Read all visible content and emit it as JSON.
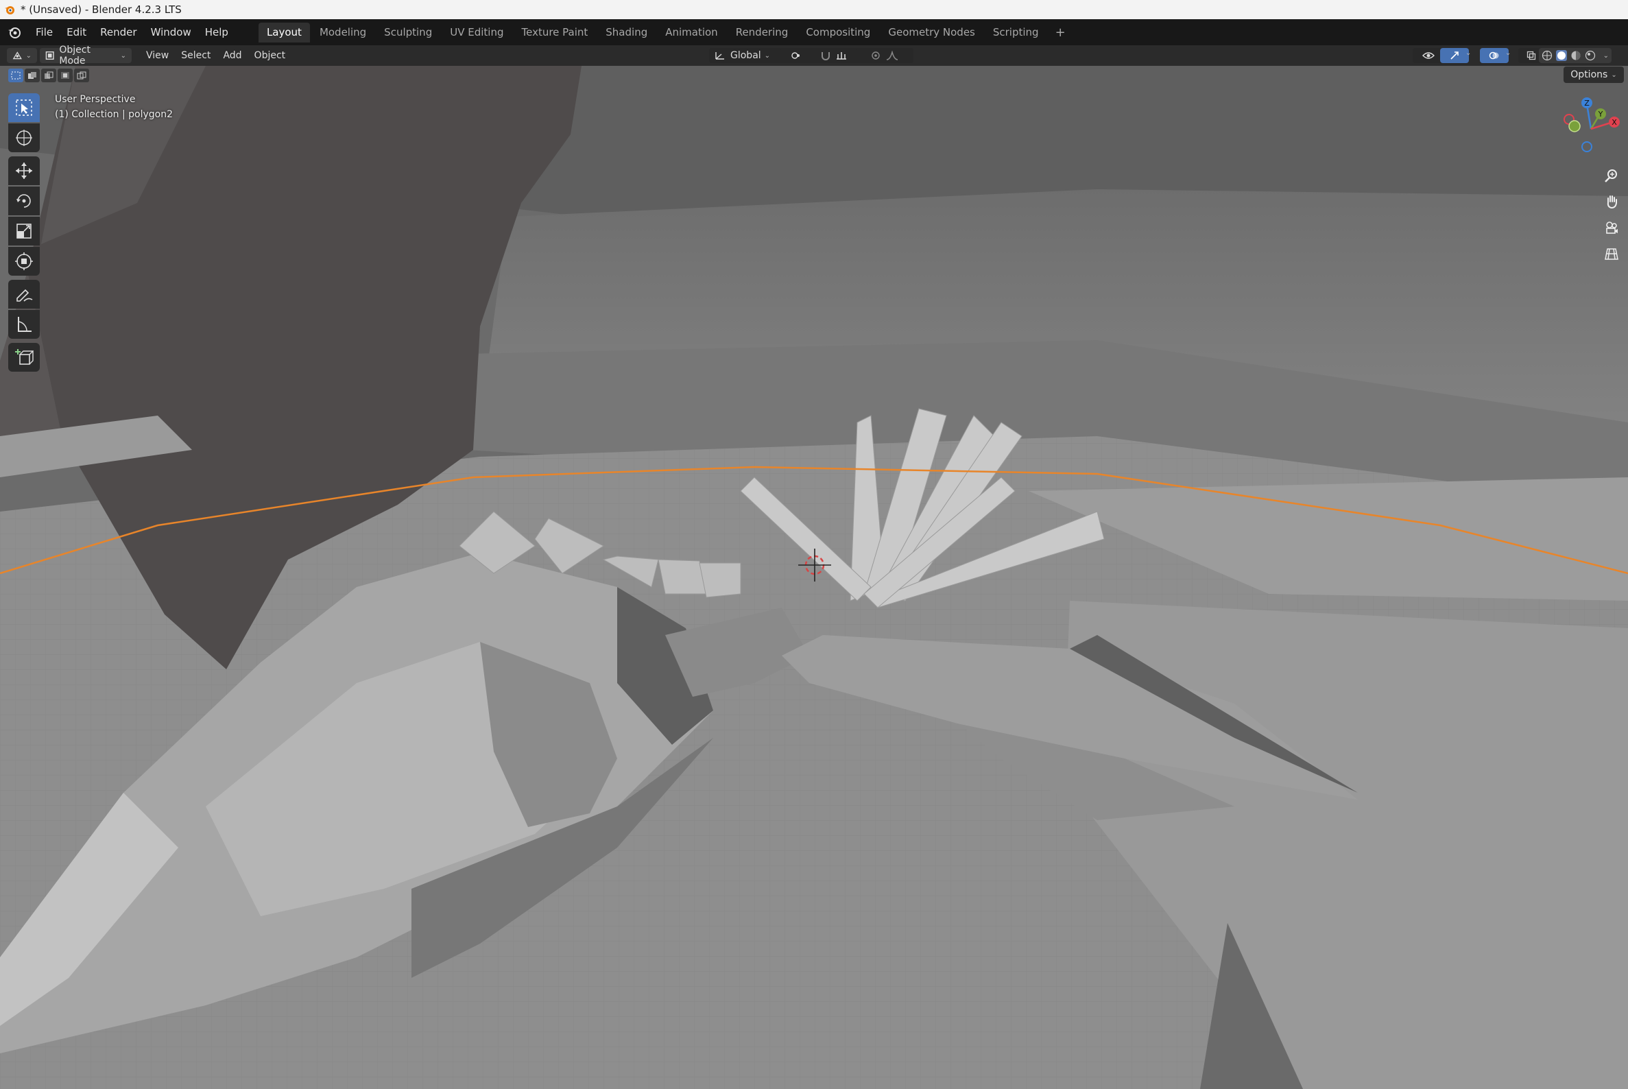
{
  "window": {
    "title": "* (Unsaved) - Blender 4.2.3 LTS"
  },
  "menubar": {
    "items": [
      "File",
      "Edit",
      "Render",
      "Window",
      "Help"
    ]
  },
  "workspaces": {
    "tabs": [
      "Layout",
      "Modeling",
      "Sculpting",
      "UV Editing",
      "Texture Paint",
      "Shading",
      "Animation",
      "Rendering",
      "Compositing",
      "Geometry Nodes",
      "Scripting"
    ],
    "active": "Layout",
    "add_label": "+"
  },
  "viewport_header": {
    "mode": "Object Mode",
    "menus": [
      "View",
      "Select",
      "Add",
      "Object"
    ],
    "orientation": "Global"
  },
  "viewport": {
    "perspective": "User Perspective",
    "collection_info": "(1) Collection | polygon2",
    "options_label": "Options"
  },
  "gizmo": {
    "axes": [
      "Z",
      "Y",
      "X"
    ],
    "colors": {
      "x": "#e0424f",
      "y": "#7aa13b",
      "z": "#3b82d9"
    }
  },
  "toolbar": {
    "tools": [
      "select-box",
      "cursor",
      "move",
      "rotate",
      "scale",
      "transform",
      "annotate",
      "measure",
      "add-cube"
    ],
    "active": "select-box"
  },
  "colors": {
    "accent": "#4772b3",
    "outline": "#e8852a",
    "header_bg": "#181818"
  }
}
